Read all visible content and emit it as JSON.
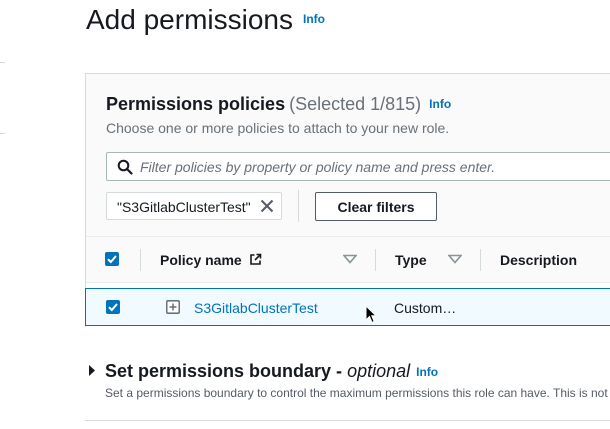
{
  "header": {
    "title": "Add permissions",
    "info": "Info"
  },
  "policies": {
    "heading": "Permissions policies",
    "selected_count": "(Selected 1/815)",
    "info": "Info",
    "description": "Choose one or more policies to attach to your new role.",
    "search": {
      "placeholder": "Filter policies by property or policy name and press enter.",
      "icon": "search-icon"
    },
    "filter_token": "\"S3GitlabClusterTest\"",
    "clear_filters_label": "Clear filters",
    "table": {
      "columns": [
        "Policy name",
        "Type",
        "Description"
      ],
      "rows": [
        {
          "selected": true,
          "name": "S3GitlabClusterTest",
          "type": "Custom…",
          "description": ""
        }
      ]
    }
  },
  "boundary": {
    "heading": "Set permissions boundary - ",
    "heading_optional": "optional",
    "info": "Info",
    "description": "Set a permissions boundary to control the maximum permissions this role can have. This is not"
  },
  "colors": {
    "link": "#0073bb",
    "text": "#16191f",
    "muted": "#687078",
    "selected_row_bg": "#f1faff",
    "border": "#d5dbdb"
  }
}
